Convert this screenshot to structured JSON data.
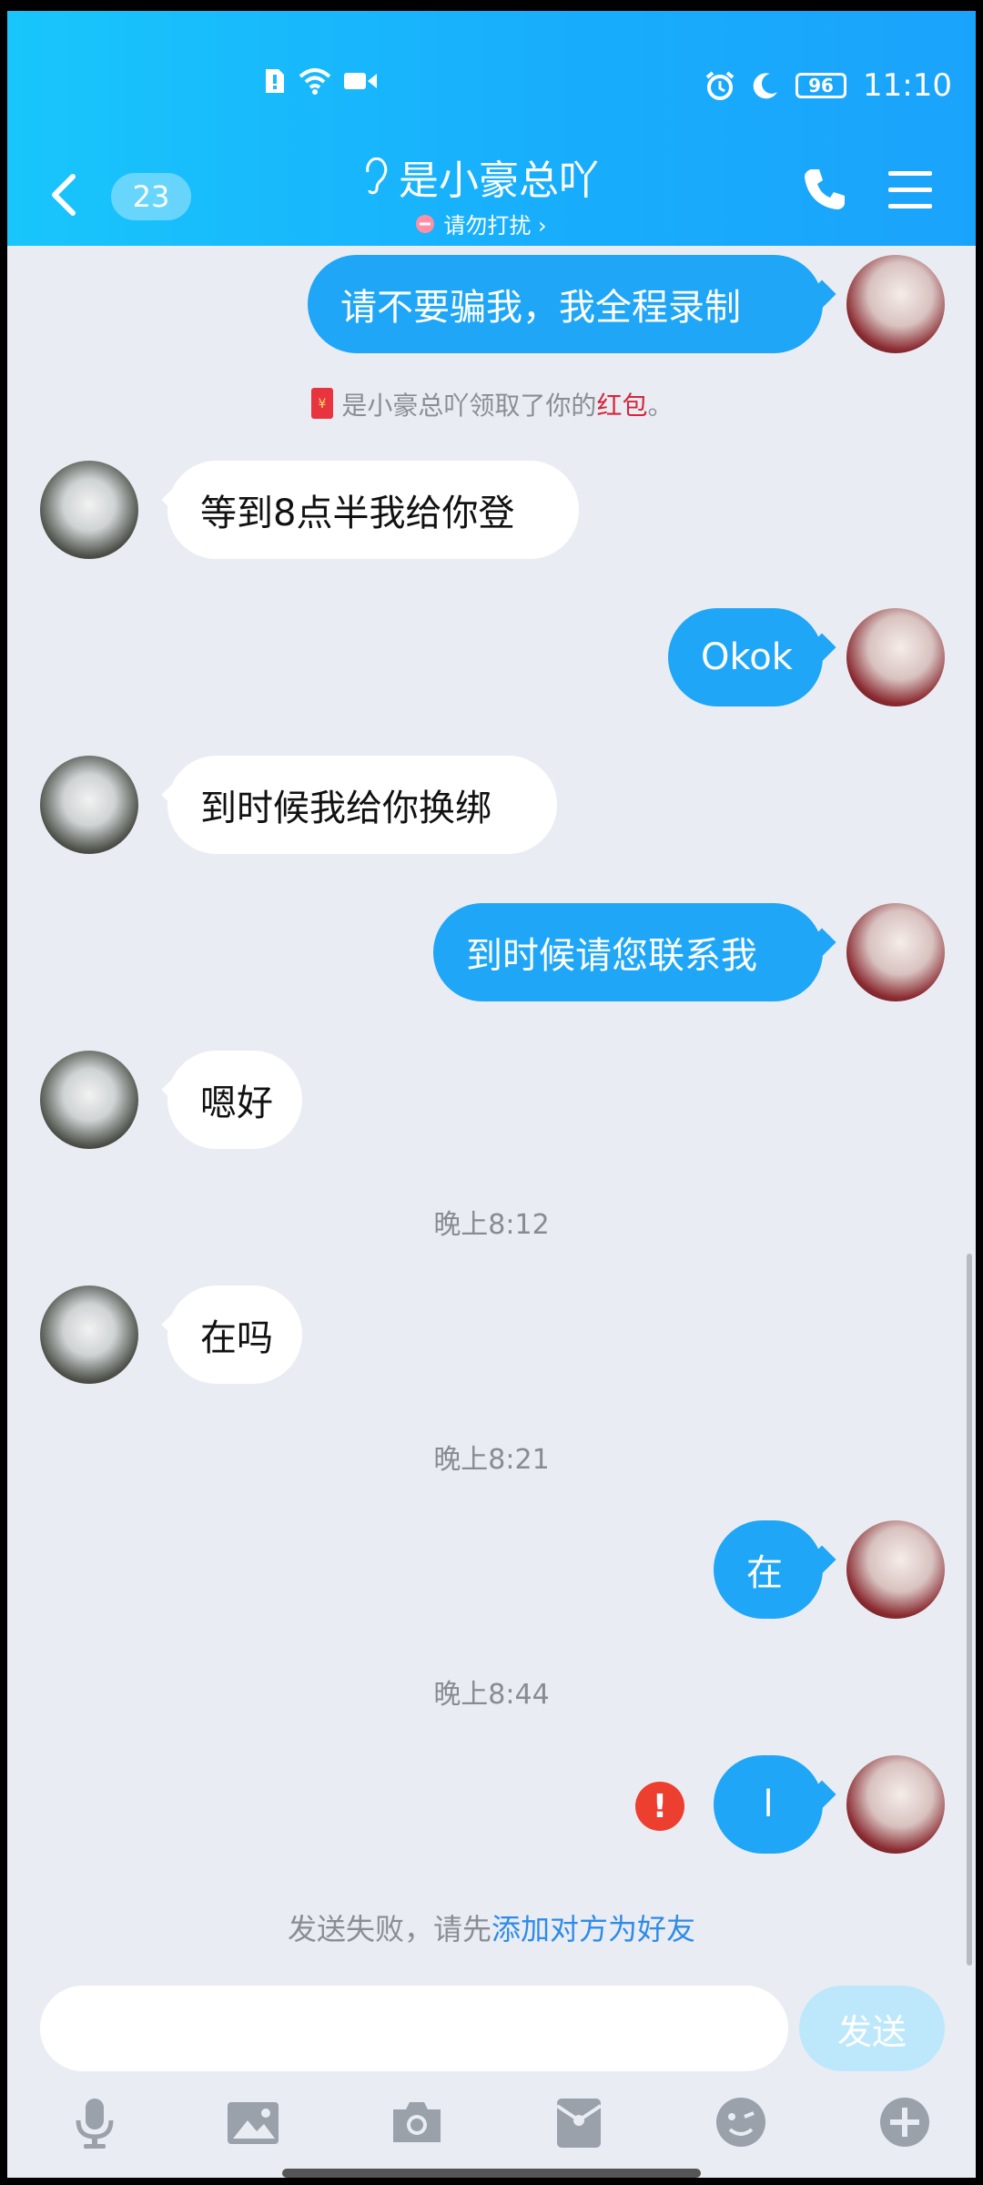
{
  "status_bar": {
    "time": "11:10",
    "battery": "96",
    "icons": [
      "sim-alert-icon",
      "wifi-icon",
      "video-camera-icon",
      "alarm-icon",
      "moon-icon",
      "battery-icon"
    ]
  },
  "header": {
    "unread_count": "23",
    "title": "是小豪总吖",
    "status": "请勿打扰 ›",
    "icons": [
      "back-icon",
      "ear-icon",
      "do-not-disturb-icon",
      "phone-icon",
      "menu-icon"
    ]
  },
  "messages": {
    "m1": "请不要骗我，我全程录制",
    "system_prefix": "是小豪总吖领取了你的",
    "system_redpacket": "红包",
    "system_suffix": "。",
    "m2": "等到8点半我给你登",
    "m3": "Okok",
    "m4": "到时候我给你换绑",
    "m5": "到时候请您联系我",
    "m6": "嗯好",
    "t1": "晚上8:12",
    "m7": "在吗",
    "t2": "晚上8:21",
    "m8": "在",
    "t3": "晚上8:44",
    "m9": "l",
    "error_mark": "!",
    "fail_prefix": "发送失败，请先",
    "fail_link": "添加对方为好友"
  },
  "input": {
    "value": "",
    "send_label": "发送"
  },
  "toolbar": {
    "items": [
      "microphone-icon",
      "image-icon",
      "camera-icon",
      "red-packet-icon",
      "emoji-icon",
      "plus-icon"
    ]
  },
  "colors": {
    "header_start": "#18c6fb",
    "header_end": "#1aa3fb",
    "bubble_me": "#1fa6f7",
    "bubble_other": "#ffffff",
    "background": "#e9edf3",
    "error": "#ec3f2f",
    "link": "#2f8be8",
    "red_packet": "#d5263b"
  }
}
